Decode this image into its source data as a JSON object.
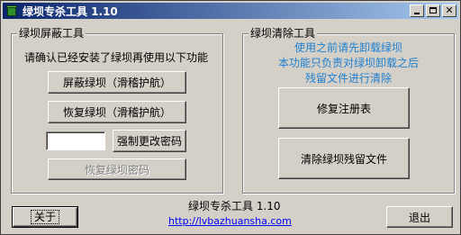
{
  "window": {
    "title": "绿坝专杀工具 1.10"
  },
  "left_group": {
    "label": "绿坝屏蔽工具",
    "instruction": "请确认已经安装了绿坝再使用以下功能",
    "block_button": "屏蔽绿坝（滑稽护航）",
    "restore_button": "恢复绿坝（滑稽护航）",
    "password_value": "",
    "force_change_button": "强制更改密码",
    "restore_password_button": "恢复绿坝密码"
  },
  "right_group": {
    "label": "绿坝清除工具",
    "notice_lines": [
      "使用之前请先卸载绿坝",
      "本功能只负责对绿坝卸载之后",
      "残留文件进行清除"
    ],
    "repair_button": "修复注册表",
    "clean_button": "清除绿坝残留文件"
  },
  "footer": {
    "app_version": "绿坝专杀工具 1.10",
    "url": "http://lvbazhuansha.com",
    "about_button": "关于",
    "exit_button": "退出"
  },
  "colors": {
    "title_start": "#0a246a",
    "title_end": "#a6caf0",
    "notice": "#1e7fd0",
    "link": "#0000ff"
  }
}
